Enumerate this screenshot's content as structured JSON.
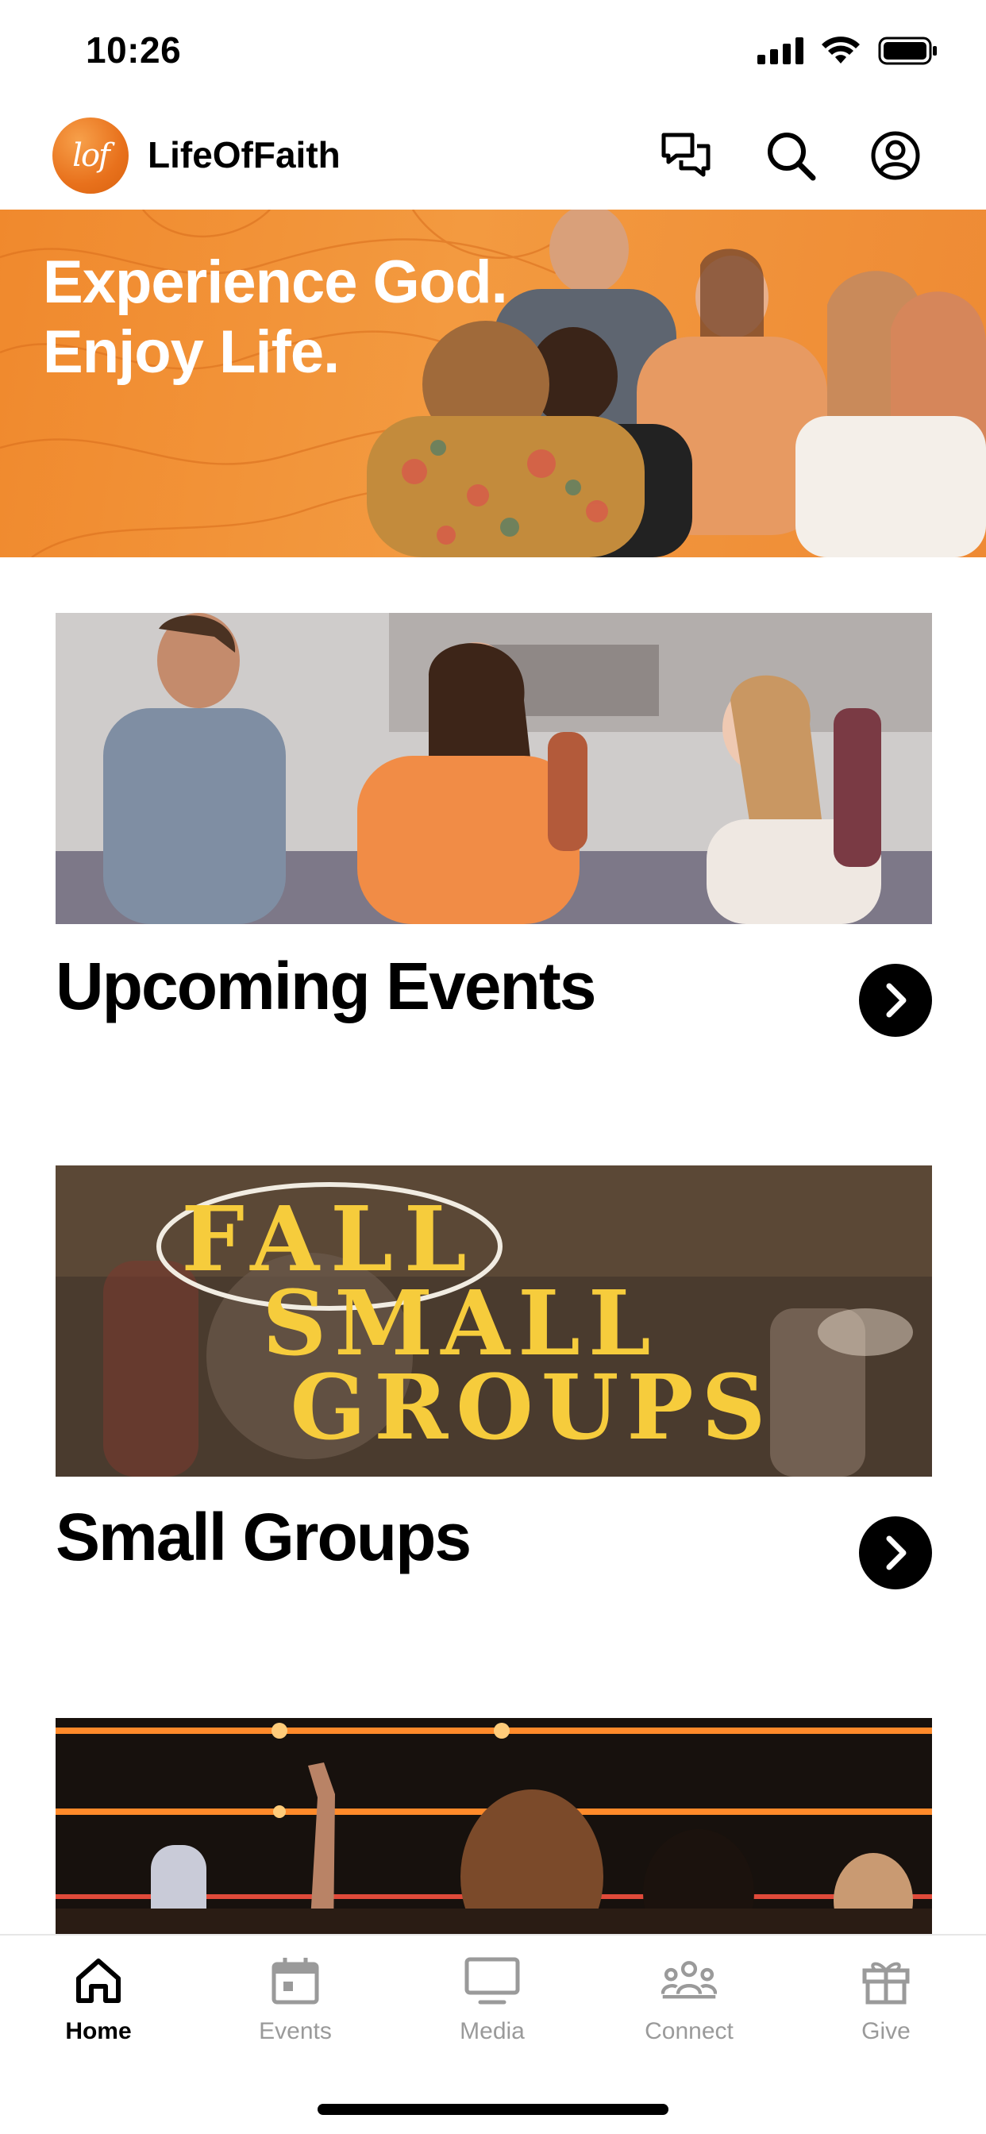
{
  "status_bar": {
    "time": "10:26"
  },
  "header": {
    "logo_text": "lof",
    "app_name": "LifeOfFaith",
    "icons": [
      "chat-icon",
      "search-icon",
      "profile-icon"
    ]
  },
  "hero": {
    "line1": "Experience God.",
    "line2": "Enjoy Life."
  },
  "cards": [
    {
      "title": "Upcoming Events",
      "image_alt": "people talking in church lobby"
    },
    {
      "title": "Small Groups",
      "image_text": [
        "FALL",
        "SMALL",
        "GROUPS"
      ]
    },
    {
      "title": "",
      "image_alt": "worship service crowd"
    }
  ],
  "tab_bar": {
    "tabs": [
      {
        "label": "Home",
        "icon": "home-icon",
        "active": true
      },
      {
        "label": "Events",
        "icon": "calendar-icon",
        "active": false
      },
      {
        "label": "Media",
        "icon": "monitor-icon",
        "active": false
      },
      {
        "label": "Connect",
        "icon": "people-icon",
        "active": false
      },
      {
        "label": "Give",
        "icon": "gift-icon",
        "active": false
      }
    ]
  },
  "colors": {
    "brand_orange": "#F08A2E",
    "active_tab": "#000000",
    "inactive_tab": "#9A9A9A"
  }
}
